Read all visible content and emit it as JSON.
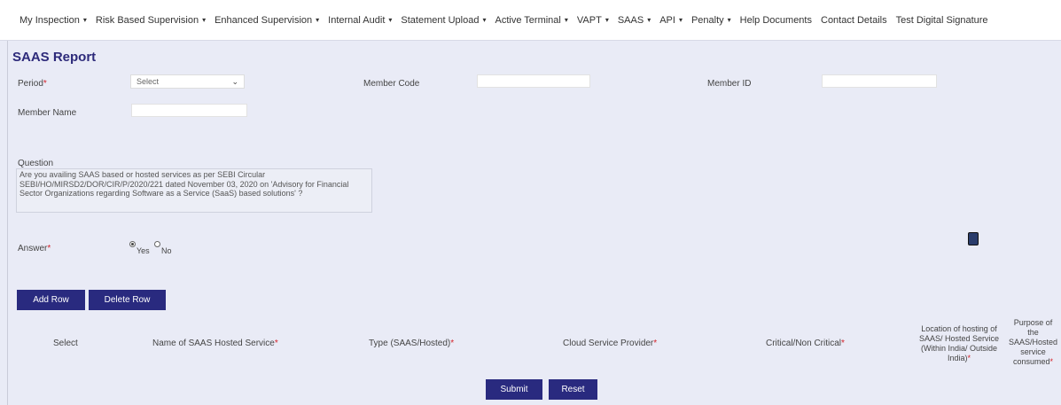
{
  "nav": [
    {
      "label": "My Inspection",
      "caret": true
    },
    {
      "label": "Risk Based Supervision",
      "caret": true
    },
    {
      "label": "Enhanced Supervision",
      "caret": true
    },
    {
      "label": "Internal Audit",
      "caret": true
    },
    {
      "label": "Statement Upload",
      "caret": true
    },
    {
      "label": "Active Terminal",
      "caret": true
    },
    {
      "label": "VAPT",
      "caret": true
    },
    {
      "label": "SAAS",
      "caret": true
    },
    {
      "label": "API",
      "caret": true
    },
    {
      "label": "Penalty",
      "caret": true
    },
    {
      "label": "Help Documents",
      "caret": false
    },
    {
      "label": "Contact Details",
      "caret": false
    },
    {
      "label": "Test Digital Signature",
      "caret": false
    }
  ],
  "page_title": "SAAS Report",
  "form": {
    "period_label": "Period",
    "period_value": "Select",
    "member_code_label": "Member Code",
    "member_id_label": "Member ID",
    "member_name_label": "Member Name",
    "question_label": "Question",
    "question_text": "Are you availing SAAS based or hosted services as per SEBI Circular SEBI/HO/MIRSD2/DOR/CIR/P/2020/221 dated November 03, 2020 on 'Advisory for Financial Sector Organizations regarding Software as a Service (SaaS) based solutions' ?",
    "answer_label": "Answer",
    "answer_yes": "Yes",
    "answer_no": "No",
    "required_mark": "*"
  },
  "buttons": {
    "add_row": "Add Row",
    "delete_row": "Delete Row",
    "submit": "Submit",
    "reset": "Reset"
  },
  "table": {
    "select": "Select",
    "service_name": "Name of SAAS Hosted Service",
    "type": "Type (SAAS/Hosted)",
    "csp": "Cloud Service Provider",
    "critical": "Critical/Non Critical",
    "location_lines": [
      "Location of hosting of",
      "SAAS/ Hosted Service",
      "(Within India/ Outside",
      "India)"
    ],
    "purpose_lines": [
      "Purpose of",
      "the",
      "SAAS/Hosted",
      "service",
      "consumed"
    ]
  },
  "colors": {
    "brand": "#292a7f",
    "required": "#d4222a",
    "page_bg": "#e9ebf6"
  }
}
